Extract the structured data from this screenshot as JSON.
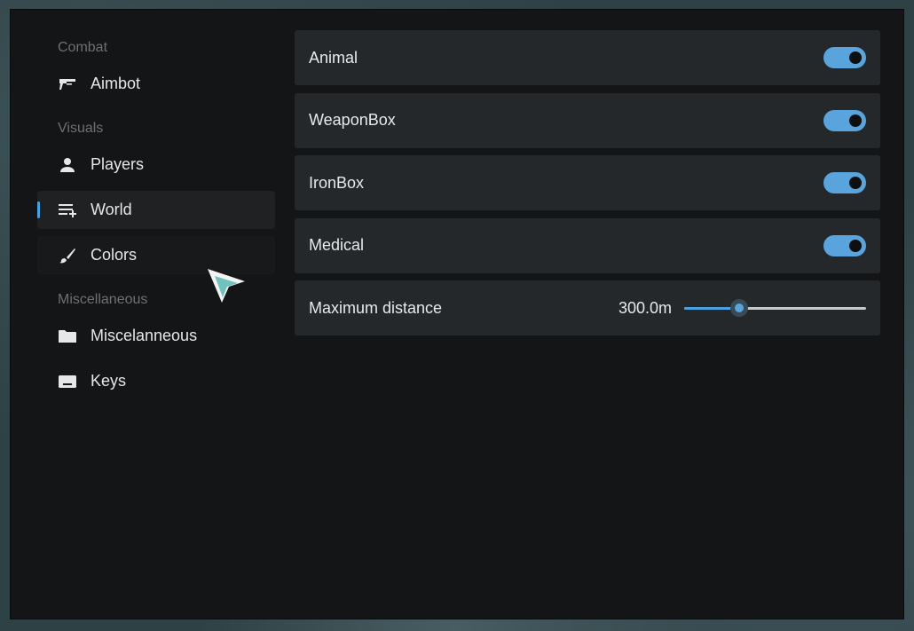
{
  "sidebar": {
    "sections": [
      {
        "label": "Combat",
        "items": [
          {
            "label": "Aimbot",
            "icon": "gun-icon"
          }
        ]
      },
      {
        "label": "Visuals",
        "items": [
          {
            "label": "Players",
            "icon": "person-icon"
          },
          {
            "label": "World",
            "icon": "playlist-add-icon",
            "active": true
          },
          {
            "label": "Colors",
            "icon": "brush-icon",
            "hover": true
          }
        ]
      },
      {
        "label": "Miscellaneous",
        "items": [
          {
            "label": "Miscelanneous",
            "icon": "folder-icon"
          },
          {
            "label": "Keys",
            "icon": "keyboard-icon"
          }
        ]
      }
    ]
  },
  "settings": {
    "toggles": [
      {
        "label": "Animal",
        "enabled": true
      },
      {
        "label": "WeaponBox",
        "enabled": true
      },
      {
        "label": "IronBox",
        "enabled": true
      },
      {
        "label": "Medical",
        "enabled": true
      }
    ],
    "max_distance": {
      "label": "Maximum distance",
      "value_text": "300.0m",
      "fraction": 0.3
    }
  },
  "colors": {
    "accent": "#5aa4de",
    "window_bg": "#131516",
    "row_bg": "#25282a",
    "cursor": "#6fc3bb"
  }
}
